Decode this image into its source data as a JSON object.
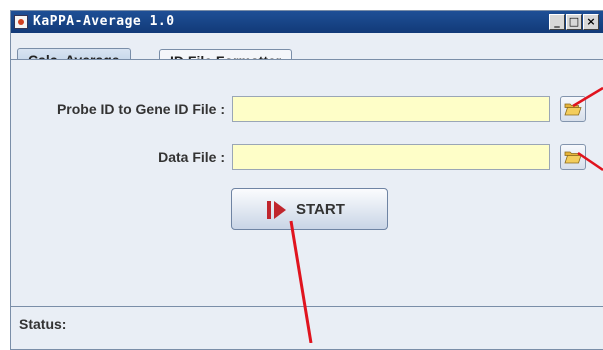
{
  "window": {
    "title": "KaPPA-Average 1.0",
    "controls": {
      "minimize": "_",
      "maximize": "□",
      "close": "×"
    }
  },
  "tabs": [
    {
      "label": "Calc. Average",
      "active": true
    },
    {
      "label": "ID File Formatter",
      "active": false
    }
  ],
  "form": {
    "probe_label": "Probe ID to Gene ID File :",
    "probe_value": "",
    "data_label": "Data File :",
    "data_value": "",
    "browse_icon": "folder-open-icon"
  },
  "start_button": {
    "label": "START",
    "icon": "play-icon"
  },
  "status": {
    "label": "Status:"
  },
  "colors": {
    "title_bar": "#1e4f96",
    "input_bg": "#fefec8",
    "panel_bg": "#e9eef5",
    "annotation": "#e0141e",
    "start_icon": "#c0262d"
  }
}
